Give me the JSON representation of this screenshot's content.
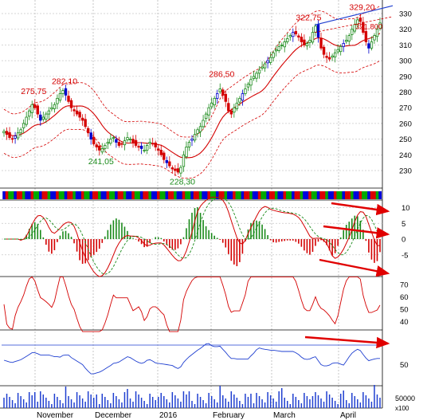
{
  "chart_data": {
    "type": "candlestick-multi-panel",
    "months": [
      "November",
      "December",
      "2016",
      "February",
      "March",
      "April"
    ],
    "price": {
      "y_ticks": [
        230,
        240,
        250,
        260,
        270,
        280,
        290,
        300,
        310,
        320,
        330
      ],
      "last_value_label": "321.800",
      "annotations": [
        {
          "text": "275,75",
          "x_index": 10,
          "value": 275.75,
          "color": "#d40000"
        },
        {
          "text": "282,10",
          "x_index": 21,
          "value": 282.1,
          "color": "#d40000"
        },
        {
          "text": "241,05",
          "x_index": 34,
          "value": 241.05,
          "color": "#1a8a1a"
        },
        {
          "text": "228,30",
          "x_index": 63,
          "value": 228.3,
          "color": "#1a8a1a"
        },
        {
          "text": "286,50",
          "x_index": 77,
          "value": 286.5,
          "color": "#d40000"
        },
        {
          "text": "322,75",
          "x_index": 108,
          "value": 322.75,
          "color": "#d40000"
        },
        {
          "text": "329,20",
          "x_index": 127,
          "value": 329.2,
          "color": "#d40000"
        }
      ],
      "closes": [
        255,
        253,
        251,
        250,
        252,
        254,
        256,
        260,
        264,
        268,
        272,
        270,
        266,
        262,
        264,
        266,
        268,
        270,
        272,
        276,
        279,
        281,
        278,
        274,
        270,
        268,
        266,
        264,
        262,
        258,
        254,
        250,
        247,
        245,
        243,
        244,
        246,
        248,
        250,
        251,
        248,
        246,
        247,
        249,
        251,
        250,
        248,
        246,
        245,
        244,
        243,
        246,
        248,
        247,
        245,
        243,
        240,
        237,
        235,
        233,
        231,
        230,
        229,
        232,
        240,
        245,
        248,
        250,
        253,
        256,
        258,
        262,
        266,
        270,
        273,
        276,
        279,
        282,
        278,
        274,
        268,
        266,
        270,
        273,
        276,
        279,
        282,
        285,
        288,
        290,
        292,
        294,
        296,
        298,
        300,
        302,
        305,
        307,
        309,
        310,
        312,
        314,
        316,
        318,
        317,
        315,
        312,
        310,
        311,
        313,
        318,
        322,
        315,
        308,
        304,
        302,
        301,
        303,
        305,
        307,
        309,
        311,
        313,
        316,
        320,
        323,
        326,
        325,
        318,
        312,
        308,
        312,
        316,
        320,
        324
      ]
    },
    "ad_bar": {
      "colors": [
        "#0000dd",
        "#00aa00",
        "#dd0000",
        "#000000"
      ]
    },
    "macd": {
      "y_ticks": [
        10,
        5,
        0,
        -5
      ]
    },
    "rsi": {
      "y_ticks": [
        70,
        60,
        50,
        40
      ]
    },
    "momentum": {
      "y_ticks": [
        50
      ]
    },
    "volume": {
      "unit_label": "x100",
      "y_ticks": [
        50000
      ]
    }
  }
}
